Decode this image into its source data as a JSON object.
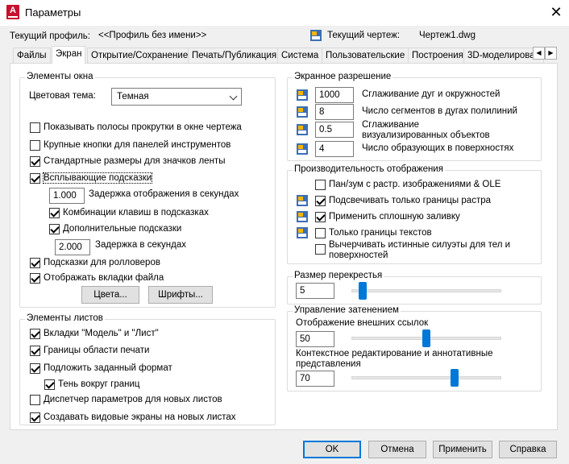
{
  "window": {
    "title": "Параметры",
    "close_glyph": "✕",
    "app_icon_letter": "A"
  },
  "header": {
    "current_profile_label": "Текущий профиль:",
    "current_profile_value": "<<Профиль без имени>>",
    "current_drawing_label": "Текущий чертеж:",
    "current_drawing_value": "Чертеж1.dwg"
  },
  "tabs": [
    "Файлы",
    "Экран",
    "Открытие/Сохранение",
    "Печать/Публикация",
    "Система",
    "Пользовательские",
    "Построения",
    "3D-моделирова"
  ],
  "active_tab": "Экран",
  "tab_scroll": {
    "left": "◀",
    "right": "▶"
  },
  "window_elements": {
    "title": "Элементы окна",
    "color_theme_label": "Цветовая тема:",
    "color_theme_value": "Темная",
    "show_scrollbars": {
      "label": "Показывать полосы прокрутки в окне чертежа",
      "checked": false
    },
    "large_buttons": {
      "label": "Крупные кнопки для панелей инструментов",
      "checked": false
    },
    "ribbon_icons": {
      "label": "Стандартные размеры для значков ленты",
      "checked": true
    },
    "tooltips": {
      "label": "Всплывающие подсказки",
      "checked": true
    },
    "tooltip_delay_value": "1.000",
    "tooltip_delay_label": "Задержка отображения в секундах",
    "shortcut_keys": {
      "label": "Комбинации клавиш в подсказках",
      "checked": true
    },
    "extended_tooltips": {
      "label": "Дополнительные подсказки",
      "checked": true
    },
    "extended_delay_value": "2.000",
    "extended_delay_label": "Задержка в секундах",
    "rollover_tooltips": {
      "label": "Подсказки для ролловеров",
      "checked": true
    },
    "file_tabs": {
      "label": "Отображать вкладки файла",
      "checked": true
    },
    "colors_button": "Цвета...",
    "fonts_button": "Шрифты..."
  },
  "layout_elements": {
    "title": "Элементы листов",
    "model_layout_tabs": {
      "label": "Вкладки \"Модель\" и \"Лист\"",
      "checked": true
    },
    "printable_area": {
      "label": "Границы области печати",
      "checked": true
    },
    "paper_background": {
      "label": "Подложить заданный формат",
      "checked": true
    },
    "paper_shadow": {
      "label": "Тень вокруг границ",
      "checked": true
    },
    "page_setup_manager": {
      "label": "Диспетчер параметров для новых листов",
      "checked": false
    },
    "create_viewport": {
      "label": "Создавать видовые экраны на новых листах",
      "checked": true
    }
  },
  "display_resolution": {
    "title": "Экранное разрешение",
    "rows": [
      {
        "value": "1000",
        "label": "Сглаживание дуг и окружностей"
      },
      {
        "value": "8",
        "label": "Число сегментов в дугах полилиний"
      },
      {
        "value": "0.5",
        "label": "Сглаживание визуализированных объектов"
      },
      {
        "value": "4",
        "label": "Число образующих в поверхностях"
      }
    ]
  },
  "display_performance": {
    "title": "Производительность отображения",
    "pan_zoom_raster": {
      "label": "Пан/зум с растр. изображениями & OLE",
      "checked": false
    },
    "highlight_raster": {
      "label": "Подсвечивать только границы растра",
      "checked": true
    },
    "apply_solid_fill": {
      "label": "Применить сплошную заливку",
      "checked": true
    },
    "text_boundary": {
      "label": "Только границы текстов",
      "checked": false
    },
    "silhouette": {
      "label": "Вычерчивать истинные силуэты для тел и поверхностей",
      "checked": false
    }
  },
  "crosshair": {
    "title": "Размер перекрестья",
    "value": "5",
    "level": 0.05
  },
  "fade_control": {
    "title": "Управление затенением",
    "xref_label": "Отображение внешних ссылок",
    "xref_value": "50",
    "xref_level": 0.5,
    "inplace_label": "Контекстное редактирование и аннотативные представления",
    "inplace_value": "70",
    "inplace_level": 0.7
  },
  "footer": {
    "ok": "OK",
    "cancel": "Отмена",
    "apply": "Применить",
    "help": "Справка"
  },
  "colors": {
    "accent": "#0078d7",
    "brand_red": "#c8102e"
  }
}
